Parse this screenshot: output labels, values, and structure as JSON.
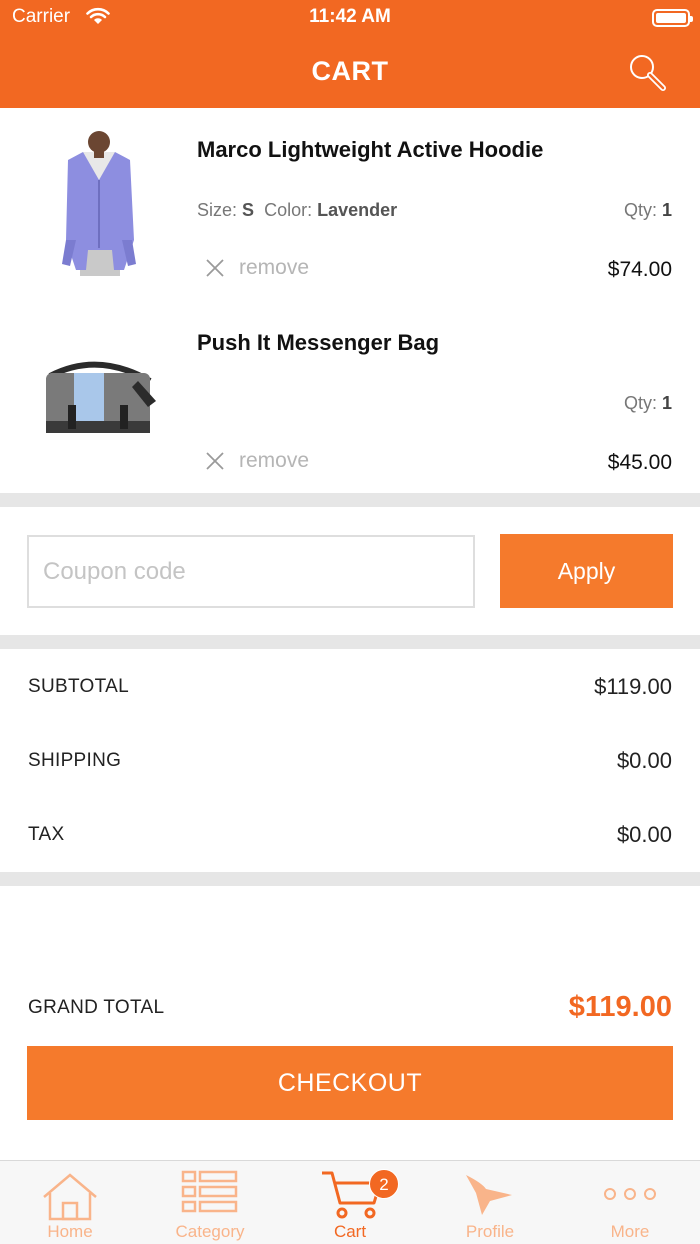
{
  "status_bar": {
    "carrier": "Carrier",
    "time": "11:42 AM"
  },
  "header": {
    "title": "CART",
    "search_icon": "search-icon"
  },
  "cart": {
    "items": [
      {
        "name": "Marco Lightweight Active Hoodie",
        "size_label": "Size:",
        "size": "S",
        "color_label": "Color:",
        "color": "Lavender",
        "qty_label": "Qty:",
        "qty": "1",
        "remove_label": "remove",
        "price": "$74.00",
        "image_icon": "hoodie-product-image"
      },
      {
        "name": "Push It Messenger Bag",
        "qty_label": "Qty:",
        "qty": "1",
        "remove_label": "remove",
        "price": "$45.00",
        "image_icon": "messenger-bag-product-image"
      }
    ]
  },
  "coupon": {
    "placeholder": "Coupon code",
    "value": "",
    "apply_label": "Apply"
  },
  "summary": {
    "subtotal_label": "SUBTOTAL",
    "subtotal": "$119.00",
    "shipping_label": "SHIPPING",
    "shipping": "$0.00",
    "tax_label": "TAX",
    "tax": "$0.00"
  },
  "grand_total": {
    "label": "GRAND TOTAL",
    "value": "$119.00"
  },
  "checkout_label": "CHECKOUT",
  "tabbar": {
    "tabs": [
      {
        "label": "Home",
        "icon": "home-icon"
      },
      {
        "label": "Category",
        "icon": "category-list-icon"
      },
      {
        "label": "Cart",
        "icon": "cart-icon",
        "badge": "2",
        "active": true
      },
      {
        "label": "Profile",
        "icon": "profile-hat-icon"
      },
      {
        "label": "More",
        "icon": "more-dots-icon"
      }
    ]
  },
  "colors": {
    "brand": "#f26822",
    "button": "#f57a2c",
    "tab_inactive": "#f9b48a",
    "separator": "#e6e6e6"
  }
}
